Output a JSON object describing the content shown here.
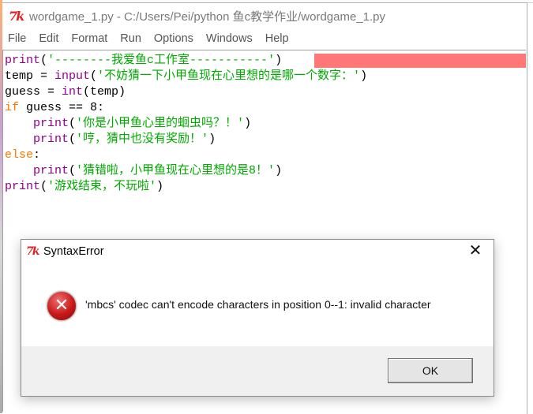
{
  "window": {
    "title": "wordgame_1.py - C:/Users/Pei/python 鱼c教学作业/wordgame_1.py",
    "app_icon": "tk-feather-icon"
  },
  "menubar": {
    "items": [
      {
        "label": "File"
      },
      {
        "label": "Edit"
      },
      {
        "label": "Format"
      },
      {
        "label": "Run"
      },
      {
        "label": "Options"
      },
      {
        "label": "Windows"
      },
      {
        "label": "Help"
      }
    ]
  },
  "editor": {
    "lines": [
      {
        "tokens": [
          {
            "t": "print",
            "c": "bi"
          },
          {
            "t": "(",
            "c": "df"
          },
          {
            "t": "'--------我爱鱼c工作室-----------'",
            "c": "st"
          },
          {
            "t": ")",
            "c": "df"
          }
        ],
        "error_highlight": true
      },
      {
        "tokens": [
          {
            "t": "temp = ",
            "c": "df"
          },
          {
            "t": "input",
            "c": "bi"
          },
          {
            "t": "(",
            "c": "df"
          },
          {
            "t": "'不妨猜一下小甲鱼现在心里想的是哪一个数字：'",
            "c": "st"
          },
          {
            "t": ")",
            "c": "df"
          }
        ]
      },
      {
        "tokens": [
          {
            "t": "guess = ",
            "c": "df"
          },
          {
            "t": "int",
            "c": "bi"
          },
          {
            "t": "(temp)",
            "c": "df"
          }
        ]
      },
      {
        "tokens": [
          {
            "t": "if",
            "c": "kw"
          },
          {
            "t": " guess == 8:",
            "c": "df"
          }
        ]
      },
      {
        "tokens": [
          {
            "t": "    ",
            "c": "df"
          },
          {
            "t": "print",
            "c": "bi"
          },
          {
            "t": "(",
            "c": "df"
          },
          {
            "t": "'你是小甲鱼心里的蛔虫吗？！'",
            "c": "st"
          },
          {
            "t": ")",
            "c": "df"
          }
        ]
      },
      {
        "tokens": [
          {
            "t": "    ",
            "c": "df"
          },
          {
            "t": "print",
            "c": "bi"
          },
          {
            "t": "(",
            "c": "df"
          },
          {
            "t": "'哼，猜中也没有奖励！'",
            "c": "st"
          },
          {
            "t": ")",
            "c": "df"
          }
        ]
      },
      {
        "tokens": [
          {
            "t": "else",
            "c": "kw"
          },
          {
            "t": ":",
            "c": "df"
          }
        ]
      },
      {
        "tokens": [
          {
            "t": "    ",
            "c": "df"
          },
          {
            "t": "print",
            "c": "bi"
          },
          {
            "t": "(",
            "c": "df"
          },
          {
            "t": "'猜错啦，小甲鱼现在心里想的是8！'",
            "c": "st"
          },
          {
            "t": ")",
            "c": "df"
          }
        ]
      },
      {
        "tokens": [
          {
            "t": "print",
            "c": "bi"
          },
          {
            "t": "(",
            "c": "df"
          },
          {
            "t": "'游戏结束，不玩啦'",
            "c": "st"
          },
          {
            "t": ")",
            "c": "df"
          }
        ]
      }
    ],
    "colors": {
      "keyword": "#ff7700",
      "builtin": "#900090",
      "string": "#00aa00",
      "default": "#000000",
      "error_highlight": "#ff7777"
    }
  },
  "dialog": {
    "title": "SyntaxError",
    "close_icon": "close-icon",
    "icon": "error-icon",
    "message": "'mbcs' codec can't encode characters in position 0--1: invalid character",
    "ok_label": "OK"
  }
}
